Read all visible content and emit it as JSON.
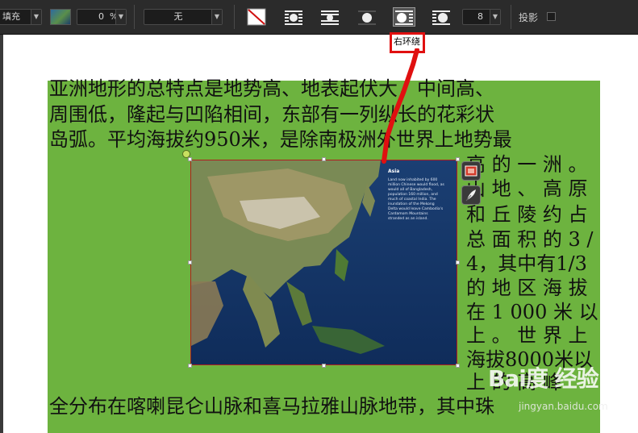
{
  "toolbar": {
    "fill_label": "填充",
    "opacity_value": "0",
    "opacity_unit": "%",
    "border_select": "无",
    "wrap_size_value": "8",
    "shadow_label": "投影"
  },
  "tooltip": {
    "text": "右环绕"
  },
  "document": {
    "lines_full": [
      "亚洲地形的总特点是地势高、地表起伏大，中间高、",
      "周围低，隆起与凹陷相间，东部有一列纵长的花彩状",
      "岛弧。平均海拔约950米，是除南极洲外世界上地势最"
    ],
    "lines_right": [
      "高 的 一 洲 。",
      "山 地 、 高 原",
      "和 丘 陵 约 占",
      "总 面 积 的 3 /",
      "4，其中有1/3",
      "的 地 区 海 拔",
      "在 1  000 米 以",
      "上 。 世 界 上",
      "海拔8000米以",
      "上 的 高 峰"
    ],
    "line_bottom": "全分布在喀喇昆仑山脉和喜马拉雅山脉地带，其中珠"
  },
  "map_caption": {
    "title": "Asia",
    "body": "Land now inhabited by 600 million Chinese would flood, as would all of Bangladesh, population 160 million, and much of coastal India. The inundation of the Mekong Delta would leave Cambodia's Cardamom Mountains stranded as an island."
  },
  "watermark": {
    "logo": "Bai度 经验",
    "url": "jingyan.baidu.com"
  },
  "colors": {
    "page": "#6db33f",
    "toolbar": "#2b2b2b",
    "highlight": "#e01010"
  }
}
